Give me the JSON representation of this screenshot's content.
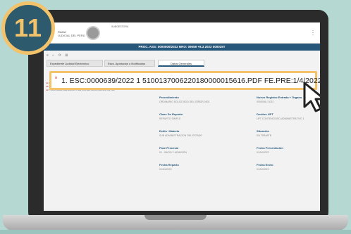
{
  "step_number": "11",
  "header": {
    "logo_line1": "RAMA",
    "logo_line2": "JUDICIAL DEL PERÚ",
    "user_name": "SUBGESTORA",
    "menu_icon": "more-vertical-icon"
  },
  "title_bar": "PROC. ASS: 0000000/2022 NRO: 09059 +8.3 2022 000025T",
  "toolbar": "≡ ⌂ ⟳ ⊞",
  "tabs": [
    "Expediente Judicial Electrónico",
    "Escs. Aportados o Notificados",
    "Datos Generales"
  ],
  "documents": [
    "1 - ESC 00000/2022 51001370062201800000 FE.PRE:1/4/2022",
    "2 - DOCUMENTO NUEVO PRESENTADO.PDF",
    "3 - ESC 00000 2022 ESCRITO DE CONTESTACION ADJUNTOS PDF"
  ],
  "highlighted_doc": "1. ESC:0000639/2022 1 5100137006220180000015616.PDF FE.PRE:1/4/2022",
  "fields": [
    {
      "label": "Procedimiento",
      "value": "ORDINARIO SOLICITADO DEL SEÑOR 0001"
    },
    {
      "label": "Nuevo Registro Entrada + Órgano",
      "value": "0000006 / 2022"
    },
    {
      "label": "Clase De Reparto",
      "value": "REPARTO SIMPLE"
    },
    {
      "label": "Destino UPT",
      "value": "UPT CONTENCIOSO-ADMINISTRATIVO 1"
    },
    {
      "label": "Estilo / Materia",
      "value": "SUB ADMINISTRACION DEL ESTADO"
    },
    {
      "label": "Situación",
      "value": "EN TRÁMITE"
    },
    {
      "label": "Fase Procesal",
      "value": "01 - INICIO Y ADMISIÓN"
    },
    {
      "label": "Fecha Presentación",
      "value": "01/04/2022"
    },
    {
      "label": "Fecha Reparto",
      "value": "01/04/2022"
    },
    {
      "label": "Fecha Envío",
      "value": "01/04/2022"
    }
  ],
  "colors": {
    "accent": "#25577a",
    "highlight": "#f2c36b",
    "badge": "#2e5a6e",
    "background": "#b5d8d3"
  }
}
